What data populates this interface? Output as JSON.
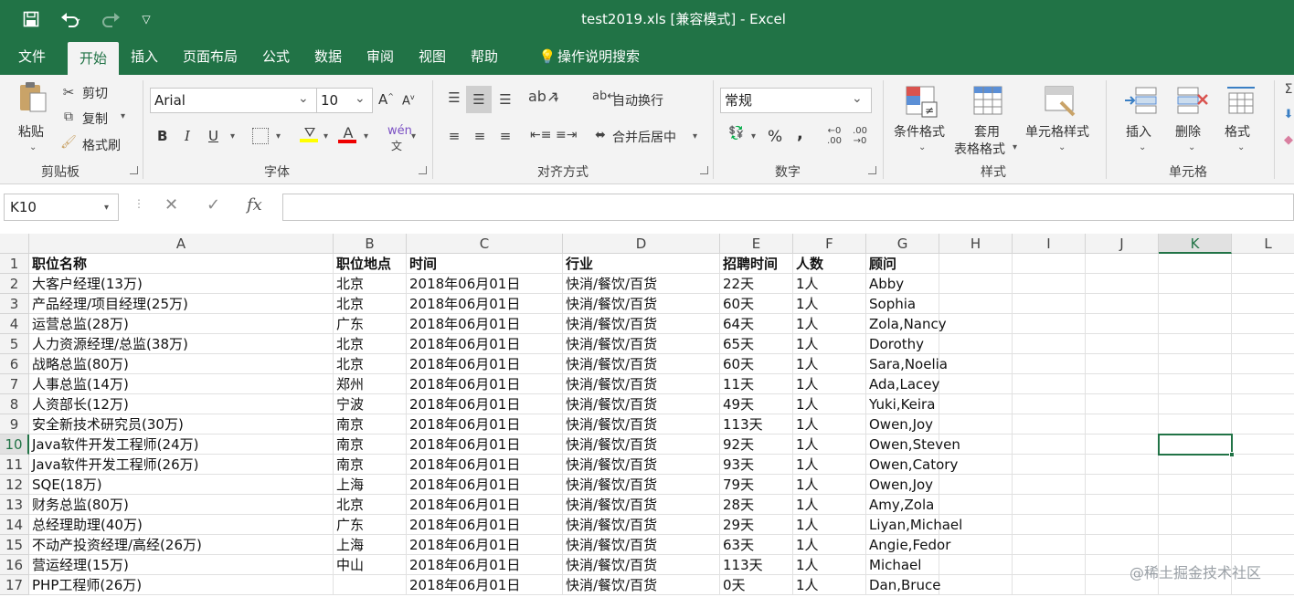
{
  "window": {
    "title": "test2019.xls  [兼容模式]  -  Excel"
  },
  "tabs": [
    "文件",
    "开始",
    "插入",
    "页面布局",
    "公式",
    "数据",
    "审阅",
    "视图",
    "帮助"
  ],
  "tell_me": "操作说明搜索",
  "ribbon": {
    "clipboard": {
      "paste": "粘贴",
      "cut": "剪切",
      "copy": "复制",
      "format_painter": "格式刷",
      "group": "剪贴板"
    },
    "font": {
      "name": "Arial",
      "size": "10",
      "bold": "B",
      "italic": "I",
      "underline": "U",
      "group": "字体"
    },
    "alignment": {
      "wrap": "自动换行",
      "merge": "合并后居中",
      "group": "对齐方式"
    },
    "number": {
      "format": "常规",
      "percent": "%",
      "comma": ",",
      "group": "数字"
    },
    "styles": {
      "conditional": "条件格式",
      "table_l1": "套用",
      "table_l2": "表格格式",
      "cell_styles": "单元格样式",
      "group": "样式"
    },
    "cells": {
      "insert": "插入",
      "delete": "删除",
      "format": "格式",
      "group": "单元格"
    }
  },
  "formula_bar": {
    "name_box": "K10",
    "formula": ""
  },
  "columns": [
    "A",
    "B",
    "C",
    "D",
    "E",
    "F",
    "G",
    "H",
    "I",
    "J",
    "K",
    "L"
  ],
  "selected_column": "K",
  "selected_row": "10",
  "rows": [
    {
      "n": "1",
      "cells": [
        "职位名称",
        "职位地点",
        "时间",
        "行业",
        "招聘时间",
        "人数",
        "顾问"
      ]
    },
    {
      "n": "2",
      "cells": [
        "大客户经理(13万)",
        "北京",
        "2018年06月01日",
        "快消/餐饮/百货",
        "22天",
        "1人",
        "Abby"
      ]
    },
    {
      "n": "3",
      "cells": [
        "产品经理/项目经理(25万)",
        "北京",
        "2018年06月01日",
        "快消/餐饮/百货",
        "60天",
        "1人",
        "Sophia"
      ]
    },
    {
      "n": "4",
      "cells": [
        "运营总监(28万)",
        "广东",
        "2018年06月01日",
        "快消/餐饮/百货",
        "64天",
        "1人",
        "Zola,Nancy"
      ]
    },
    {
      "n": "5",
      "cells": [
        "人力资源经理/总监(38万)",
        "北京",
        "2018年06月01日",
        "快消/餐饮/百货",
        "65天",
        "1人",
        "Dorothy"
      ]
    },
    {
      "n": "6",
      "cells": [
        "战略总监(80万)",
        "北京",
        "2018年06月01日",
        "快消/餐饮/百货",
        "60天",
        "1人",
        "Sara,Noelia"
      ]
    },
    {
      "n": "7",
      "cells": [
        "人事总监(14万)",
        "郑州",
        "2018年06月01日",
        "快消/餐饮/百货",
        "11天",
        "1人",
        "Ada,Lacey"
      ]
    },
    {
      "n": "8",
      "cells": [
        "人资部长(12万)",
        "宁波",
        "2018年06月01日",
        "快消/餐饮/百货",
        "49天",
        "1人",
        "Yuki,Keira"
      ]
    },
    {
      "n": "9",
      "cells": [
        "安全新技术研究员(30万)",
        "南京",
        "2018年06月01日",
        "快消/餐饮/百货",
        "113天",
        "1人",
        "Owen,Joy"
      ]
    },
    {
      "n": "10",
      "cells": [
        "Java软件开发工程师(24万)",
        "南京",
        "2018年06月01日",
        "快消/餐饮/百货",
        "92天",
        "1人",
        "Owen,Steven"
      ]
    },
    {
      "n": "11",
      "cells": [
        "Java软件开发工程师(26万)",
        "南京",
        "2018年06月01日",
        "快消/餐饮/百货",
        "93天",
        "1人",
        "Owen,Catory"
      ]
    },
    {
      "n": "12",
      "cells": [
        "SQE(18万)",
        "上海",
        "2018年06月01日",
        "快消/餐饮/百货",
        "79天",
        "1人",
        "Owen,Joy"
      ]
    },
    {
      "n": "13",
      "cells": [
        "财务总监(80万)",
        "北京",
        "2018年06月01日",
        "快消/餐饮/百货",
        "28天",
        "1人",
        "Amy,Zola"
      ]
    },
    {
      "n": "14",
      "cells": [
        "总经理助理(40万)",
        "广东",
        "2018年06月01日",
        "快消/餐饮/百货",
        "29天",
        "1人",
        "Liyan,Michael"
      ]
    },
    {
      "n": "15",
      "cells": [
        "不动产投资经理/高经(26万)",
        "上海",
        "2018年06月01日",
        "快消/餐饮/百货",
        "63天",
        "1人",
        "Angie,Fedor"
      ]
    },
    {
      "n": "16",
      "cells": [
        "营运经理(15万)",
        "中山",
        "2018年06月01日",
        "快消/餐饮/百货",
        "113天",
        "1人",
        "Michael"
      ]
    },
    {
      "n": "17",
      "cells": [
        "PHP工程师(26万)",
        "",
        "2018年06月01日",
        "快消/餐饮/百货",
        "0天",
        "1人",
        "Dan,Bruce"
      ]
    }
  ],
  "watermark": "@稀土掘金技术社区",
  "colors": {
    "accent": "#217346",
    "ribbon_bg": "#f3f3f3"
  }
}
